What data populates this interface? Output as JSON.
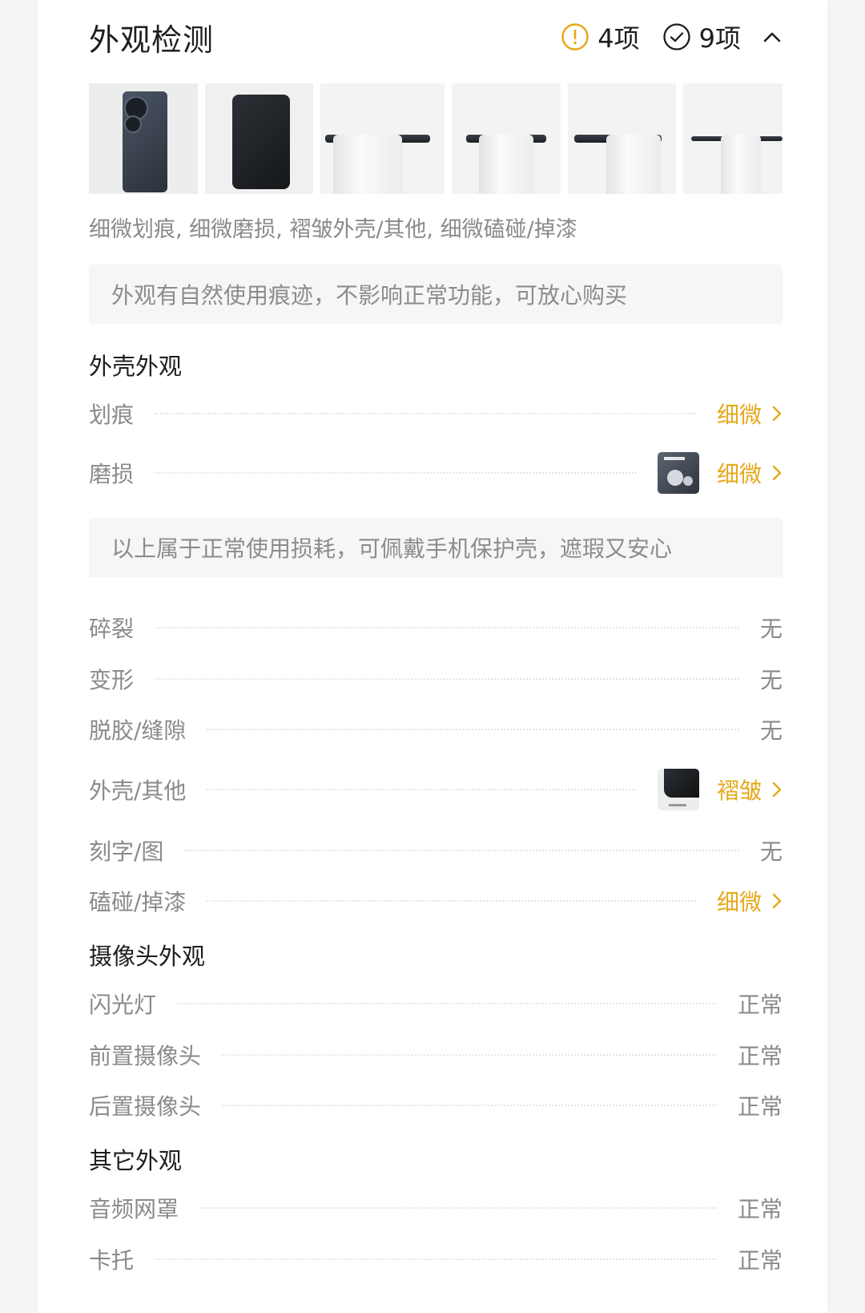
{
  "header": {
    "title": "外观检测",
    "warn_count": "4项",
    "ok_count": "9项"
  },
  "colors": {
    "warn": "#e6a81a",
    "text": "#1e1e1e",
    "muted": "#8a8a8a"
  },
  "summary": "细微划痕, 细微磨损, 褶皱外壳/其他, 细微磕碰/掉漆",
  "note_1": "外观有自然使用痕迹，不影响正常功能，可放心购买",
  "note_2": "以上属于正常使用损耗，可佩戴手机保护壳，遮瑕又安心",
  "sections": {
    "shell": "外壳外观",
    "camera": "摄像头外观",
    "other": "其它外观"
  },
  "rows": [
    {
      "label": "划痕",
      "value": "细微"
    },
    {
      "label": "磨损",
      "value": "细微"
    },
    {
      "label": "碎裂",
      "value": "无"
    },
    {
      "label": "变形",
      "value": "无"
    },
    {
      "label": "脱胶/缝隙",
      "value": "无"
    },
    {
      "label": "外壳/其他",
      "value": "褶皱"
    },
    {
      "label": "刻字/图",
      "value": "无"
    },
    {
      "label": "磕碰/掉漆",
      "value": "细微"
    },
    {
      "label": "闪光灯",
      "value": "正常"
    },
    {
      "label": "前置摄像头",
      "value": "正常"
    },
    {
      "label": "后置摄像头",
      "value": "正常"
    },
    {
      "label": "音频网罩",
      "value": "正常"
    },
    {
      "label": "卡托",
      "value": "正常"
    }
  ]
}
